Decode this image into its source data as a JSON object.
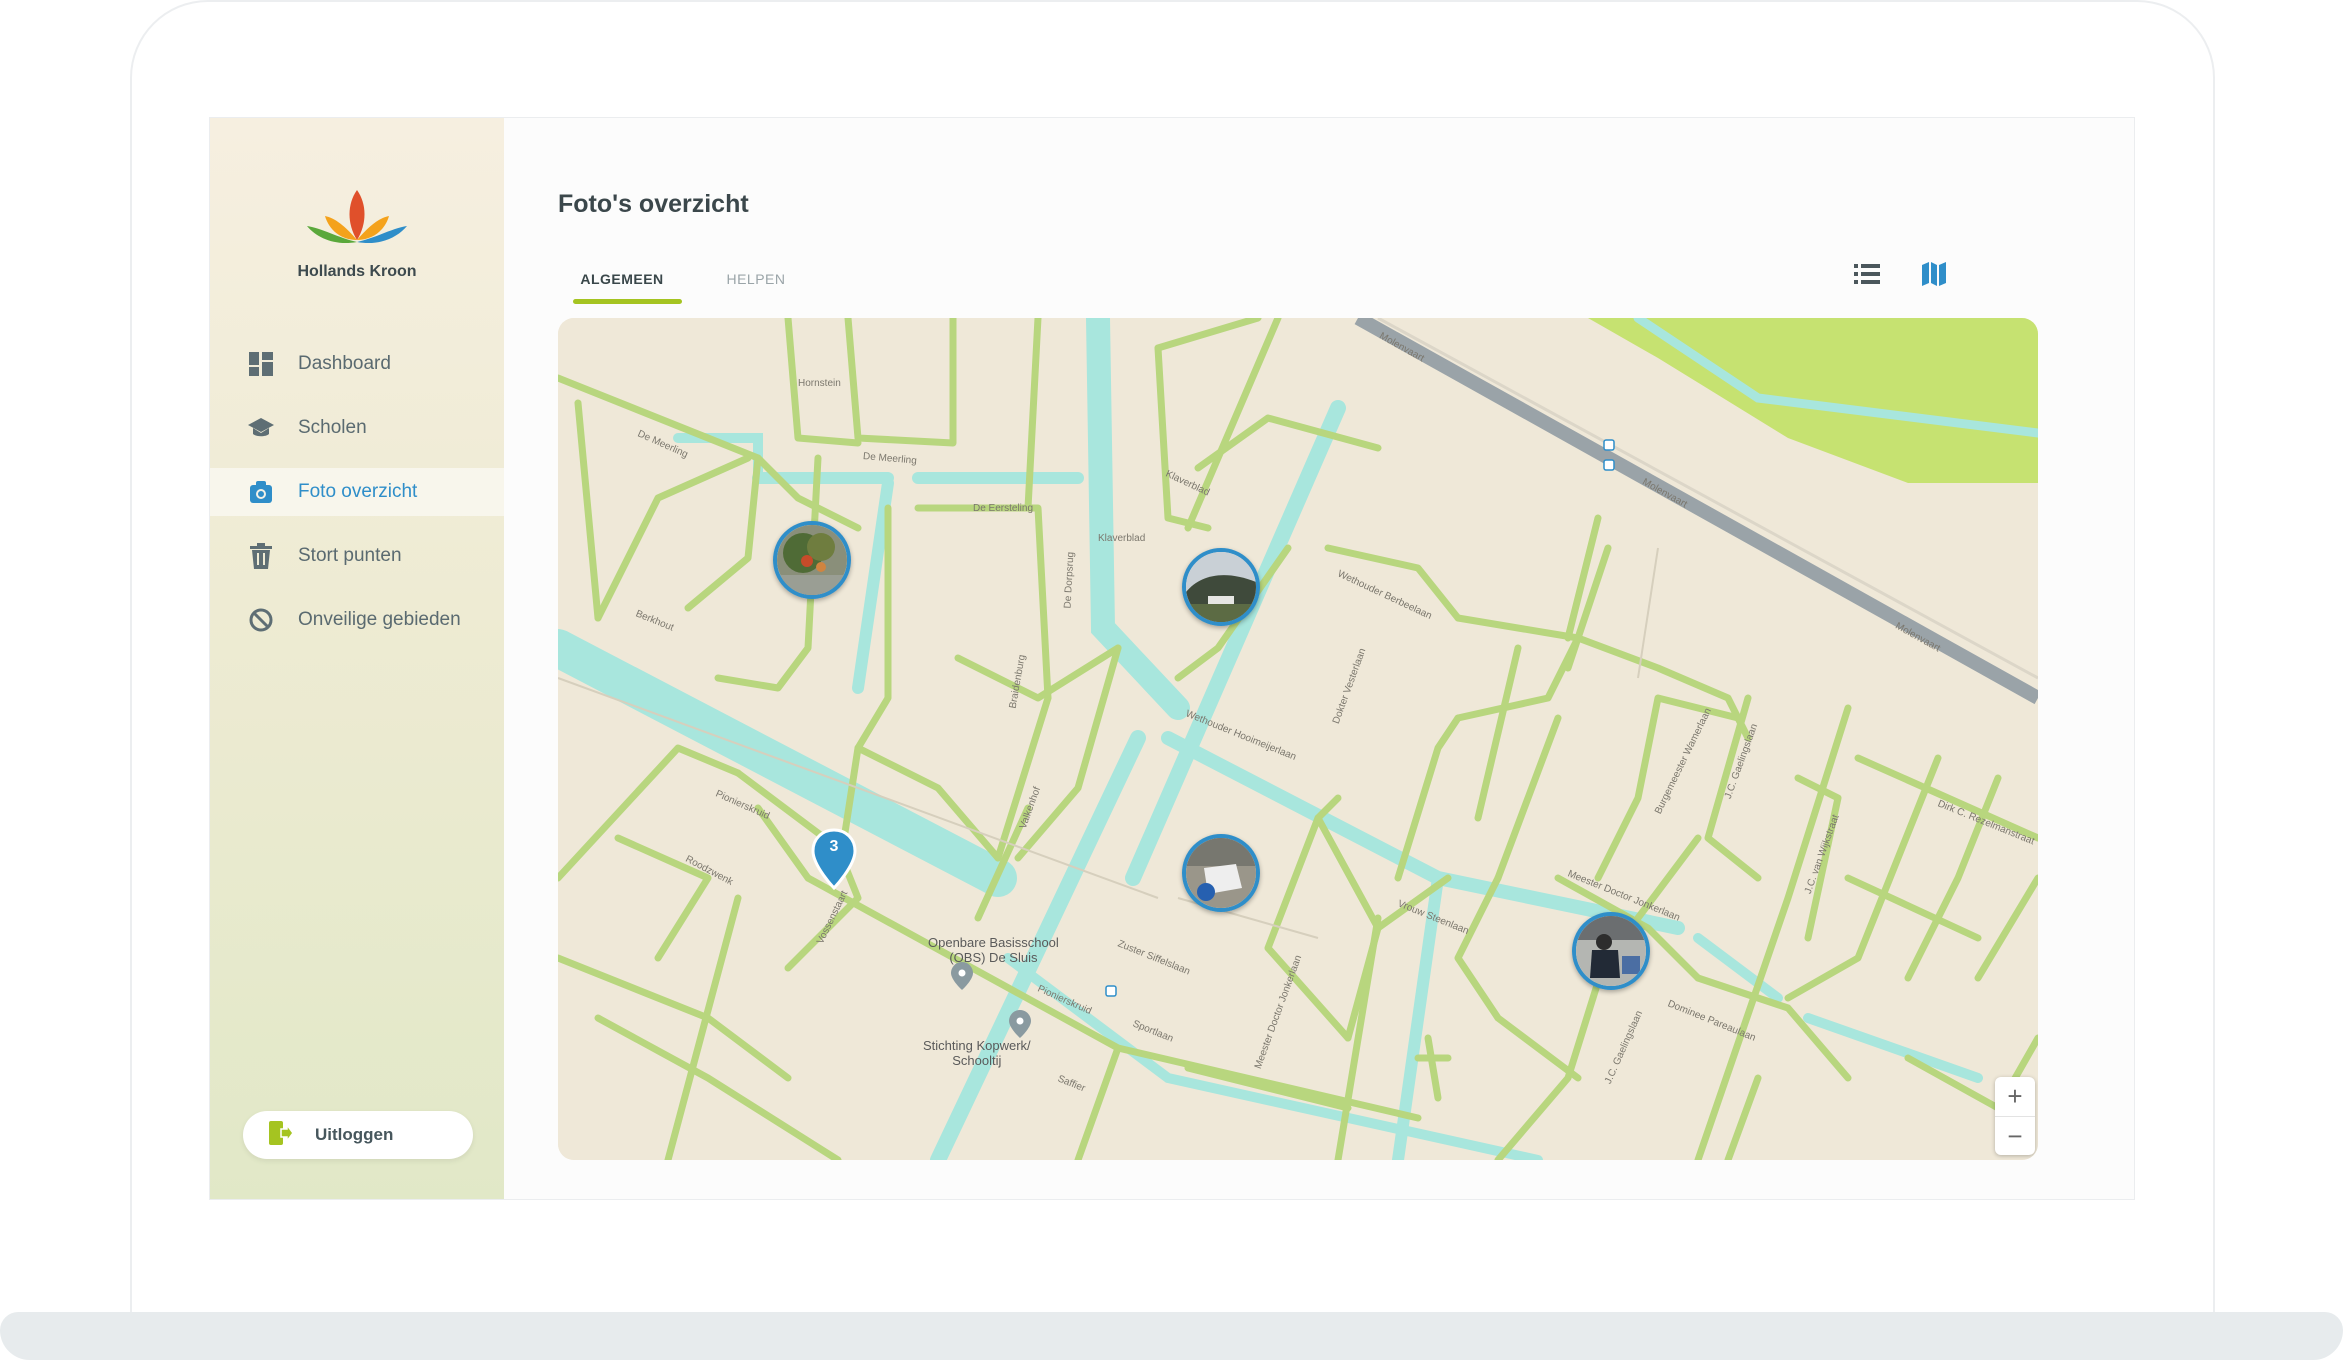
{
  "app": {
    "brand_name": "Hollands Kroon"
  },
  "sidebar": {
    "items": [
      {
        "label": "Dashboard",
        "icon": "dashboard-icon",
        "active": false
      },
      {
        "label": "Scholen",
        "icon": "graduation-cap-icon",
        "active": false
      },
      {
        "label": "Foto overzicht",
        "icon": "camera-icon",
        "active": true
      },
      {
        "label": "Stort punten",
        "icon": "trash-icon",
        "active": false
      },
      {
        "label": "Onveilige gebieden",
        "icon": "forbidden-icon",
        "active": false
      }
    ],
    "logout_label": "Uitloggen"
  },
  "main": {
    "title": "Foto's overzicht",
    "tabs": [
      {
        "label": "ALGEMEEN",
        "active": true
      },
      {
        "label": "HELPEN",
        "active": false
      }
    ],
    "view_options": [
      {
        "icon": "list-view-icon",
        "active": false
      },
      {
        "icon": "map-view-icon",
        "active": true
      }
    ]
  },
  "map": {
    "cluster_count": "3",
    "zoom_in": "+",
    "zoom_out": "−",
    "poi": {
      "school": "Openbare Basisschool\n(OBS) De Sluis",
      "foundation": "Stichting Kopwerk/\nSchooltij"
    },
    "street_labels": {
      "molenvaart": "Molenvaart",
      "hornstein": "Hornstein",
      "de_meerling": "De Meerling",
      "de_eersteling": "De Eersteling",
      "klaverblad": "Klaverblad",
      "wethouder_berbeelaan": "Wethouder Berbeelaan",
      "pionierskruid": "Pionierskruid",
      "roodzwenk": "Roodzwenk",
      "vossenstaart": "Vossenstaart",
      "zuster_siffelslaan": "Zuster Siffelslaan",
      "meester_doctor_jonkerlaan": "Meester Doctor Jonkerlaan",
      "vrouw_steenlaan": "Vrouw Steenlaan",
      "dominee_pareaulaan": "Dominee Pareaulaan",
      "sportlaan": "Sportlaan",
      "saffier": "Saffier",
      "berkhout": "Berkhout",
      "valkenhof": "Valkenhof",
      "braidenburg": "Braidenburg",
      "de_dorpsrug": "De Dorpsrug",
      "jc_gaelingslaan": "J.C. Gaelingslaan",
      "jc_van_wijkstraat": "J.C. van Wijkstraat",
      "dirk_c_rezelmanstraat": "Dirk C. Rezelmanstraat",
      "wethouder_hooimeijerlaan": "Wethouder Hooimeijerlaan",
      "dokter_vesterlaan": "Dokter Vesterlaan",
      "burgemeester_wamerlaan": "Burgemeester Wamerlaan"
    }
  },
  "colors": {
    "accent": "#2f8ec9",
    "tab_underline": "#a5c421",
    "map_background": "#efe8d8",
    "road": "#b8d67e",
    "water": "#a8e6dd",
    "motorway": "#9aa3a8",
    "grass": "#c6e271"
  }
}
